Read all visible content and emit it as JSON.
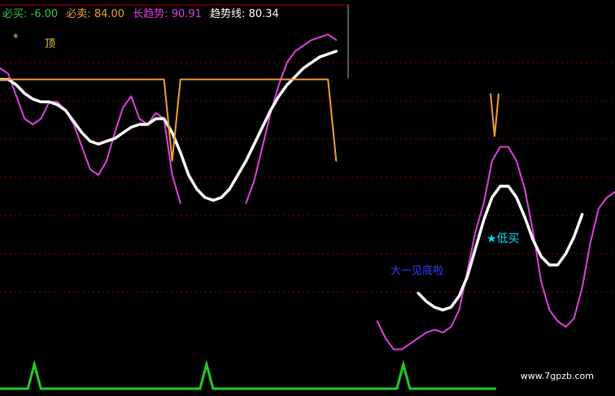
{
  "legend": {
    "buy_label": "必买: ",
    "buy_value": "-6.00",
    "sell_label": "必卖: ",
    "sell_value": "84.00",
    "longtrend_label": "长趋势: ",
    "longtrend_value": "90.91",
    "trendline_label": "趋势线: ",
    "trendline_value": "80.34"
  },
  "annotations": {
    "star": "*",
    "top": "顶",
    "low_buy": "★低买",
    "blue_text": "大一见底啦"
  },
  "watermark": "www.7gpzb.com",
  "colors": {
    "background": "#000000",
    "grid": "#8b0000",
    "buy": "#2ecc40",
    "sell": "#f0a030",
    "longtrend": "#e040e0",
    "trendline": "#ffffff",
    "signal_line": "#f0a030",
    "bottom_line": "#22cc22",
    "cyan_label": "#00e0ff",
    "blue_label": "#3040ff"
  },
  "chart_data": {
    "type": "line",
    "x": [
      0,
      1,
      2,
      3,
      4,
      5,
      6,
      7,
      8,
      9,
      10,
      11,
      12,
      13,
      14,
      15,
      16,
      17,
      18,
      19,
      20,
      21,
      22,
      23,
      24,
      25,
      26,
      27,
      28,
      29,
      30,
      31,
      32,
      33,
      34,
      35,
      36,
      37,
      38,
      39,
      40,
      41,
      42,
      43,
      44,
      45,
      46,
      47,
      48,
      49,
      50,
      51,
      52,
      53,
      54,
      55,
      56,
      57,
      58,
      59,
      60,
      61,
      62,
      63,
      64,
      65,
      66,
      67,
      68,
      69,
      70,
      71,
      72,
      73,
      74,
      75
    ],
    "ylim": [
      -15,
      105
    ],
    "series": [
      {
        "name": "长趋势",
        "values": [
          88,
          86,
          78,
          70,
          68,
          70,
          76,
          76,
          73,
          68,
          60,
          52,
          50,
          55,
          65,
          74,
          78,
          70,
          68,
          72,
          70,
          50,
          40,
          null,
          null,
          null,
          null,
          null,
          null,
          null,
          40,
          48,
          60,
          72,
          82,
          90,
          94,
          96,
          98,
          99,
          100,
          98,
          null,
          null,
          null,
          null,
          -2,
          -8,
          -12,
          -12,
          -10,
          -8,
          -6,
          -5,
          -6,
          -4,
          2,
          16,
          30,
          40,
          55,
          60,
          60,
          55,
          45,
          30,
          12,
          2,
          -2,
          -4,
          -1,
          10,
          26,
          38,
          42,
          44
        ]
      },
      {
        "name": "趋势线",
        "values": [
          84,
          84,
          82,
          79,
          77,
          76,
          76,
          75,
          73,
          69,
          65,
          62,
          61,
          62,
          63,
          65,
          67,
          68,
          68,
          70,
          70,
          65,
          58,
          50,
          45,
          42,
          41,
          42,
          45,
          50,
          55,
          61,
          67,
          73,
          78,
          82,
          85,
          88,
          90,
          92,
          93,
          94,
          null,
          null,
          null,
          null,
          null,
          null,
          null,
          null,
          null,
          8,
          5,
          3,
          2,
          3,
          7,
          14,
          24,
          34,
          42,
          46,
          46,
          42,
          35,
          27,
          21,
          18,
          18,
          22,
          28,
          36
        ],
        "gaps": "partial"
      },
      {
        "name": "顶",
        "values": [
          84,
          84,
          84,
          84,
          84,
          84,
          84,
          84,
          84,
          84,
          84,
          84,
          84,
          84,
          84,
          84,
          84,
          84,
          84,
          84,
          84,
          55,
          84,
          84,
          84,
          84,
          84,
          84,
          84,
          84,
          84,
          84,
          84,
          84,
          84,
          84,
          84,
          84,
          84,
          84,
          84,
          55
        ]
      }
    ],
    "signal_x": [
      3,
      24,
      48
    ]
  }
}
